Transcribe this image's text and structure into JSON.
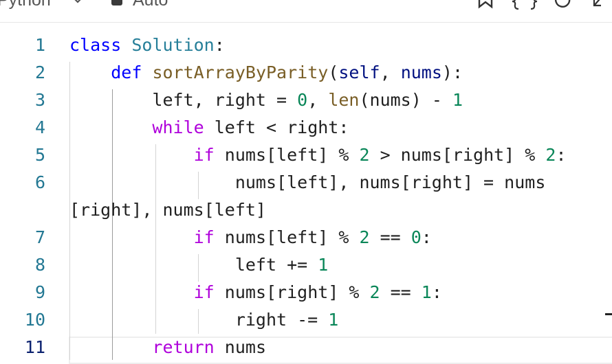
{
  "toolbar": {
    "language": "Python",
    "mode": "Auto",
    "icons": [
      "chevron-down-icon",
      "square-icon",
      "bookmark-icon",
      "braces-icon",
      "reset-icon",
      "collapse-icon"
    ]
  },
  "editor": {
    "lines": [
      {
        "n": "1",
        "indent": "",
        "tokens": [
          [
            "kw-blue",
            "class"
          ],
          [
            "t",
            " "
          ],
          [
            "cls",
            "Solution"
          ],
          [
            "t",
            ":"
          ]
        ]
      },
      {
        "n": "2",
        "indent": "    ",
        "tokens": [
          [
            "kw-blue",
            "def"
          ],
          [
            "t",
            " "
          ],
          [
            "fn",
            "sortArrayByParity"
          ],
          [
            "t",
            "("
          ],
          [
            "param",
            "self"
          ],
          [
            "t",
            ", "
          ],
          [
            "param",
            "nums"
          ],
          [
            "t",
            "):"
          ]
        ]
      },
      {
        "n": "3",
        "indent": "        ",
        "tokens": [
          [
            "t",
            "left, right = "
          ],
          [
            "num",
            "0"
          ],
          [
            "t",
            ", "
          ],
          [
            "builtin",
            "len"
          ],
          [
            "t",
            "(nums) - "
          ],
          [
            "num",
            "1"
          ]
        ]
      },
      {
        "n": "4",
        "indent": "        ",
        "tokens": [
          [
            "kw-purple",
            "while"
          ],
          [
            "t",
            " left < right:"
          ]
        ]
      },
      {
        "n": "5",
        "indent": "            ",
        "tokens": [
          [
            "kw-purple",
            "if"
          ],
          [
            "t",
            " nums[left] % "
          ],
          [
            "num",
            "2"
          ],
          [
            "t",
            " > nums[right] % "
          ],
          [
            "num",
            "2"
          ],
          [
            "t",
            ":"
          ]
        ]
      },
      {
        "n": "6",
        "indent": "                ",
        "tokens": [
          [
            "t",
            "nums[left], nums[right] = nums"
          ]
        ]
      },
      {
        "n": "",
        "indent": "",
        "tokens": [
          [
            "t",
            "[right], nums[left]"
          ]
        ]
      },
      {
        "n": "7",
        "indent": "            ",
        "tokens": [
          [
            "kw-purple",
            "if"
          ],
          [
            "t",
            " nums[left] % "
          ],
          [
            "num",
            "2"
          ],
          [
            "t",
            " == "
          ],
          [
            "num",
            "0"
          ],
          [
            "t",
            ":"
          ]
        ]
      },
      {
        "n": "8",
        "indent": "                ",
        "tokens": [
          [
            "t",
            "left += "
          ],
          [
            "num",
            "1"
          ]
        ]
      },
      {
        "n": "9",
        "indent": "            ",
        "tokens": [
          [
            "kw-purple",
            "if"
          ],
          [
            "t",
            " nums[right] % "
          ],
          [
            "num",
            "2"
          ],
          [
            "t",
            " == "
          ],
          [
            "num",
            "1"
          ],
          [
            "t",
            ":"
          ]
        ]
      },
      {
        "n": "10",
        "indent": "                ",
        "tokens": [
          [
            "t",
            "right -= "
          ],
          [
            "num",
            "1"
          ]
        ]
      },
      {
        "n": "11",
        "indent": "        ",
        "tokens": [
          [
            "kw-purple",
            "return"
          ],
          [
            "t",
            " nums"
          ]
        ]
      }
    ],
    "active_line": "11"
  },
  "colors": {
    "keyword": "#0000ff",
    "control": "#af00db",
    "class": "#267f99",
    "function": "#795e26",
    "number": "#098658",
    "line_number": "#237893"
  }
}
